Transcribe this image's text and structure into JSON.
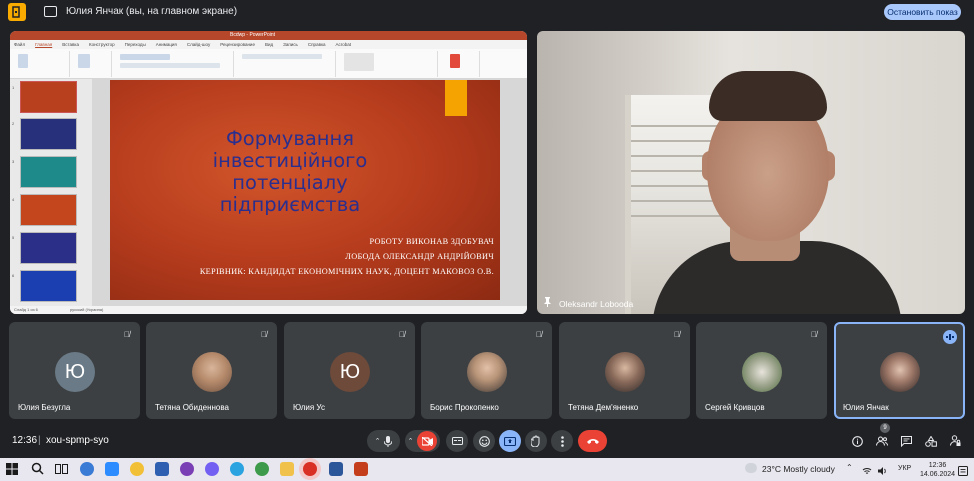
{
  "topbar": {
    "share_title": "Юлия Янчак (вы, на главном экране)",
    "stop_button": "Остановить показ"
  },
  "presentation": {
    "window_title": "Bcdwp - PowerPoint",
    "tabs": [
      "Файл",
      "Главная",
      "Вставка",
      "Конструктор",
      "Переходы",
      "Анимация",
      "Слайд-шоу",
      "Рецензирование",
      "Вид",
      "Запись",
      "Справка",
      "Acrobat"
    ],
    "slide_title": "Формування інвестиційного потенціалу підприємства",
    "slide_lines": [
      "РОБОТУ ВИКОНАВ ЗДОБУВАЧ",
      "ЛОБОДА ОЛЕКСАНДР АНДРІЙОВИЧ",
      "КЕРІВНИК: КАНДИДАТ ЕКОНОМІЧНИХ НАУК, ДОЦЕНТ МАКОВОЗ О.В."
    ],
    "thumb_numbers": [
      "1",
      "2",
      "3",
      "4",
      "5",
      "6"
    ],
    "status_text": "Слайд 1 из 6",
    "status_lang": "русский (Украина)"
  },
  "camera": {
    "name": "Oleksandr Lobooda"
  },
  "participants": [
    {
      "name": "Юлия Безугла",
      "initial": "Ю",
      "avatar_color": "#6a7a86"
    },
    {
      "name": "Тетяна Обиденнова",
      "initial": "",
      "avatar_color": "#b58a6b"
    },
    {
      "name": "Юлия Ус",
      "initial": "Ю",
      "avatar_color": "#6e4a3a"
    },
    {
      "name": "Борис Прокопенко",
      "initial": "",
      "avatar_color": "#7a6a5a"
    },
    {
      "name": "Тетяна Дем'яненко",
      "initial": "",
      "avatar_color": "#8a7a70"
    },
    {
      "name": "Сергей Кривцов",
      "initial": "",
      "avatar_color": "#9aa28a"
    },
    {
      "name": "Юлия Янчак",
      "initial": "",
      "avatar_color": "#5a4a48"
    }
  ],
  "bottombar": {
    "time": "12:36",
    "separator": "|",
    "meeting_code": "xou-spmp-syo",
    "people_count": "9"
  },
  "taskbar": {
    "weather": "23°C  Mostly cloudy",
    "language": "УКР",
    "clock_time": "12:36",
    "clock_date": "14.06.2024"
  },
  "colors": {
    "meet_bg": "#202124",
    "tile_bg": "#3c4043",
    "end_call_red": "#ea4335",
    "accent_blue": "#8ab4f8",
    "slide_bg": "#b83d1c",
    "slide_title": "#2a2f8f"
  }
}
